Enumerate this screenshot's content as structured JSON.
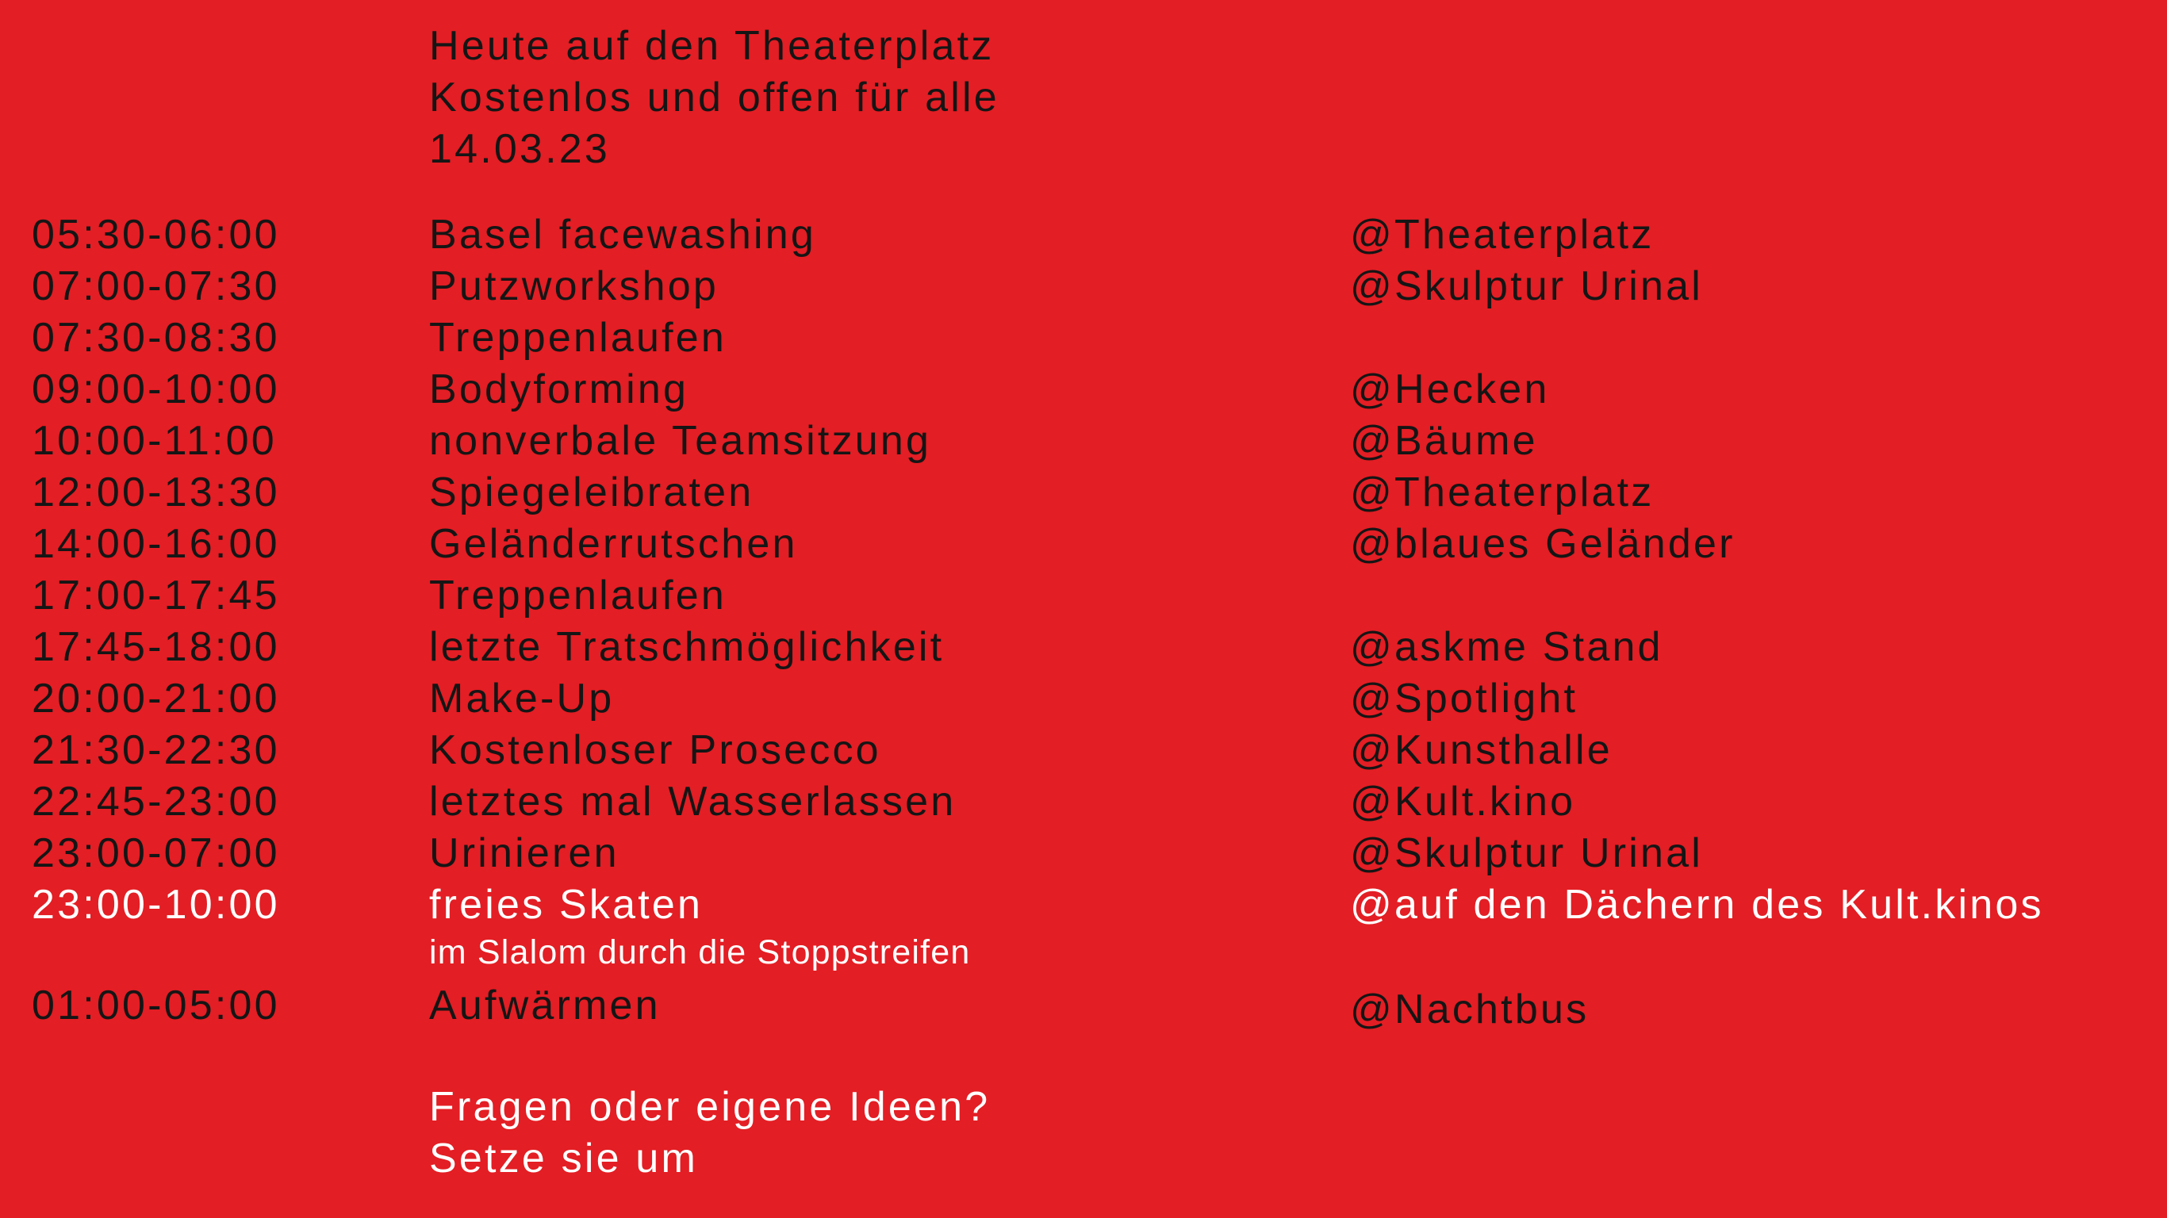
{
  "header": {
    "line1": "Heute auf den Theaterplatz",
    "line2": "Kostenlos und offen für alle",
    "date": "14.03.23"
  },
  "schedule": [
    {
      "time": "05:30-06:00",
      "event": "Basel facewashing",
      "location": "@Theaterplatz"
    },
    {
      "time": "07:00-07:30",
      "event": "Putzworkshop",
      "location": "@Skulptur Urinal"
    },
    {
      "time": "07:30-08:30",
      "event": "Treppenlaufen",
      "location": ""
    },
    {
      "time": "09:00-10:00",
      "event": "Bodyforming",
      "location": "@Hecken"
    },
    {
      "time": "10:00-11:00",
      "event": "nonverbale Teamsitzung",
      "location": "@Bäume"
    },
    {
      "time": "12:00-13:30",
      "event": "Spiegeleibraten",
      "location": "@Theaterplatz"
    },
    {
      "time": "14:00-16:00",
      "event": "Geländerrutschen",
      "location": "@blaues Geländer"
    },
    {
      "time": "17:00-17:45",
      "event": "Treppenlaufen",
      "location": ""
    },
    {
      "time": "17:45-18:00",
      "event": "letzte Tratschmöglichkeit",
      "location": "@askme Stand"
    },
    {
      "time": "20:00-21:00",
      "event": "Make-Up",
      "location": "@Spotlight"
    },
    {
      "time": "21:30-22:30",
      "event": "Kostenloser Prosecco",
      "location": "@Kunsthalle"
    },
    {
      "time": "22:45-23:00",
      "event": "letztes mal Wasserlassen",
      "location": "@Kult.kino"
    },
    {
      "time": "23:00-07:00",
      "event": "Urinieren",
      "location": "@Skulptur Urinal"
    },
    {
      "time": "23:00-10:00",
      "event": "freies Skaten",
      "location": "@auf den Dächern des Kult.kinos",
      "note": "im Slalom durch die Stoppstreifen"
    },
    {
      "time": "01:00-05:00",
      "event": "Aufwärmen",
      "location": "@Nachtbus"
    }
  ],
  "footer": {
    "line1": "Fragen oder eigene Ideen?",
    "line2": "Setze sie um"
  },
  "colors": {
    "background": "#e31e24",
    "dark_text": "#151515",
    "light_text": "#ffffff"
  }
}
